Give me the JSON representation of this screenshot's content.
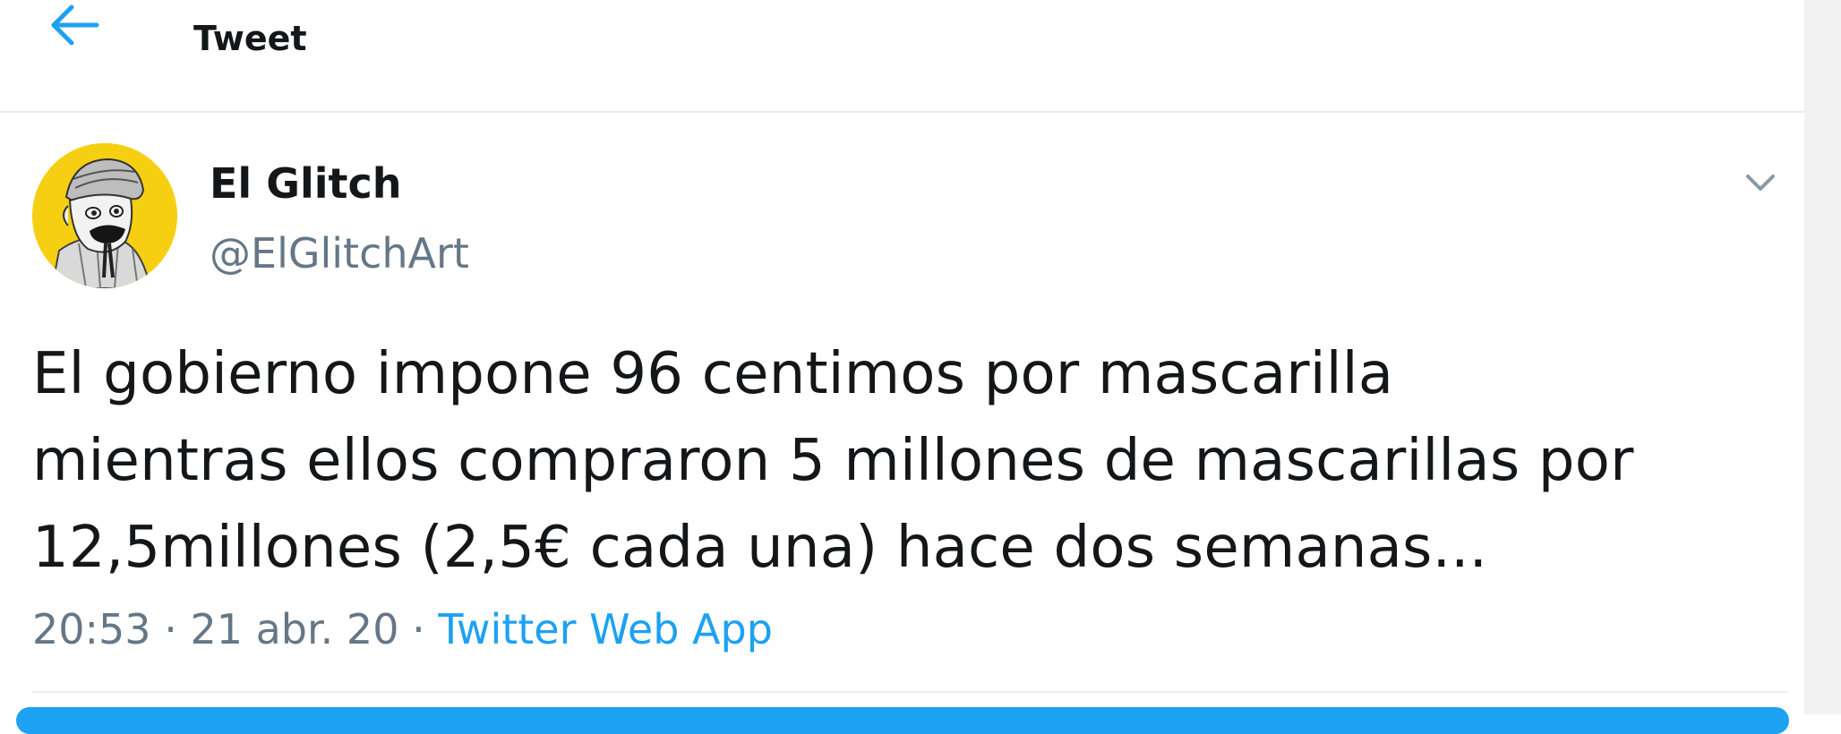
{
  "header": {
    "title": "Tweet",
    "back_icon": "arrow-left-icon"
  },
  "tweet": {
    "author": {
      "display_name": "El Glitch",
      "handle": "@ElGlitchArt",
      "avatar_bg": "#f6cf12"
    },
    "text": "El gobierno impone 96 centimos por mascarilla\nmientras ellos compraron 5 millones de mascarillas por\n12,5millones (2,5€ cada una) hace dos semanas...",
    "time": "20:53",
    "separator": " · ",
    "date": "21 abr. 20",
    "source": "Twitter Web App",
    "menu_icon": "chevron-down-icon"
  },
  "colors": {
    "accent": "#1da1f2",
    "secondary_text": "#657786",
    "primary_text": "#14171a",
    "divider": "#e6ecf0"
  }
}
